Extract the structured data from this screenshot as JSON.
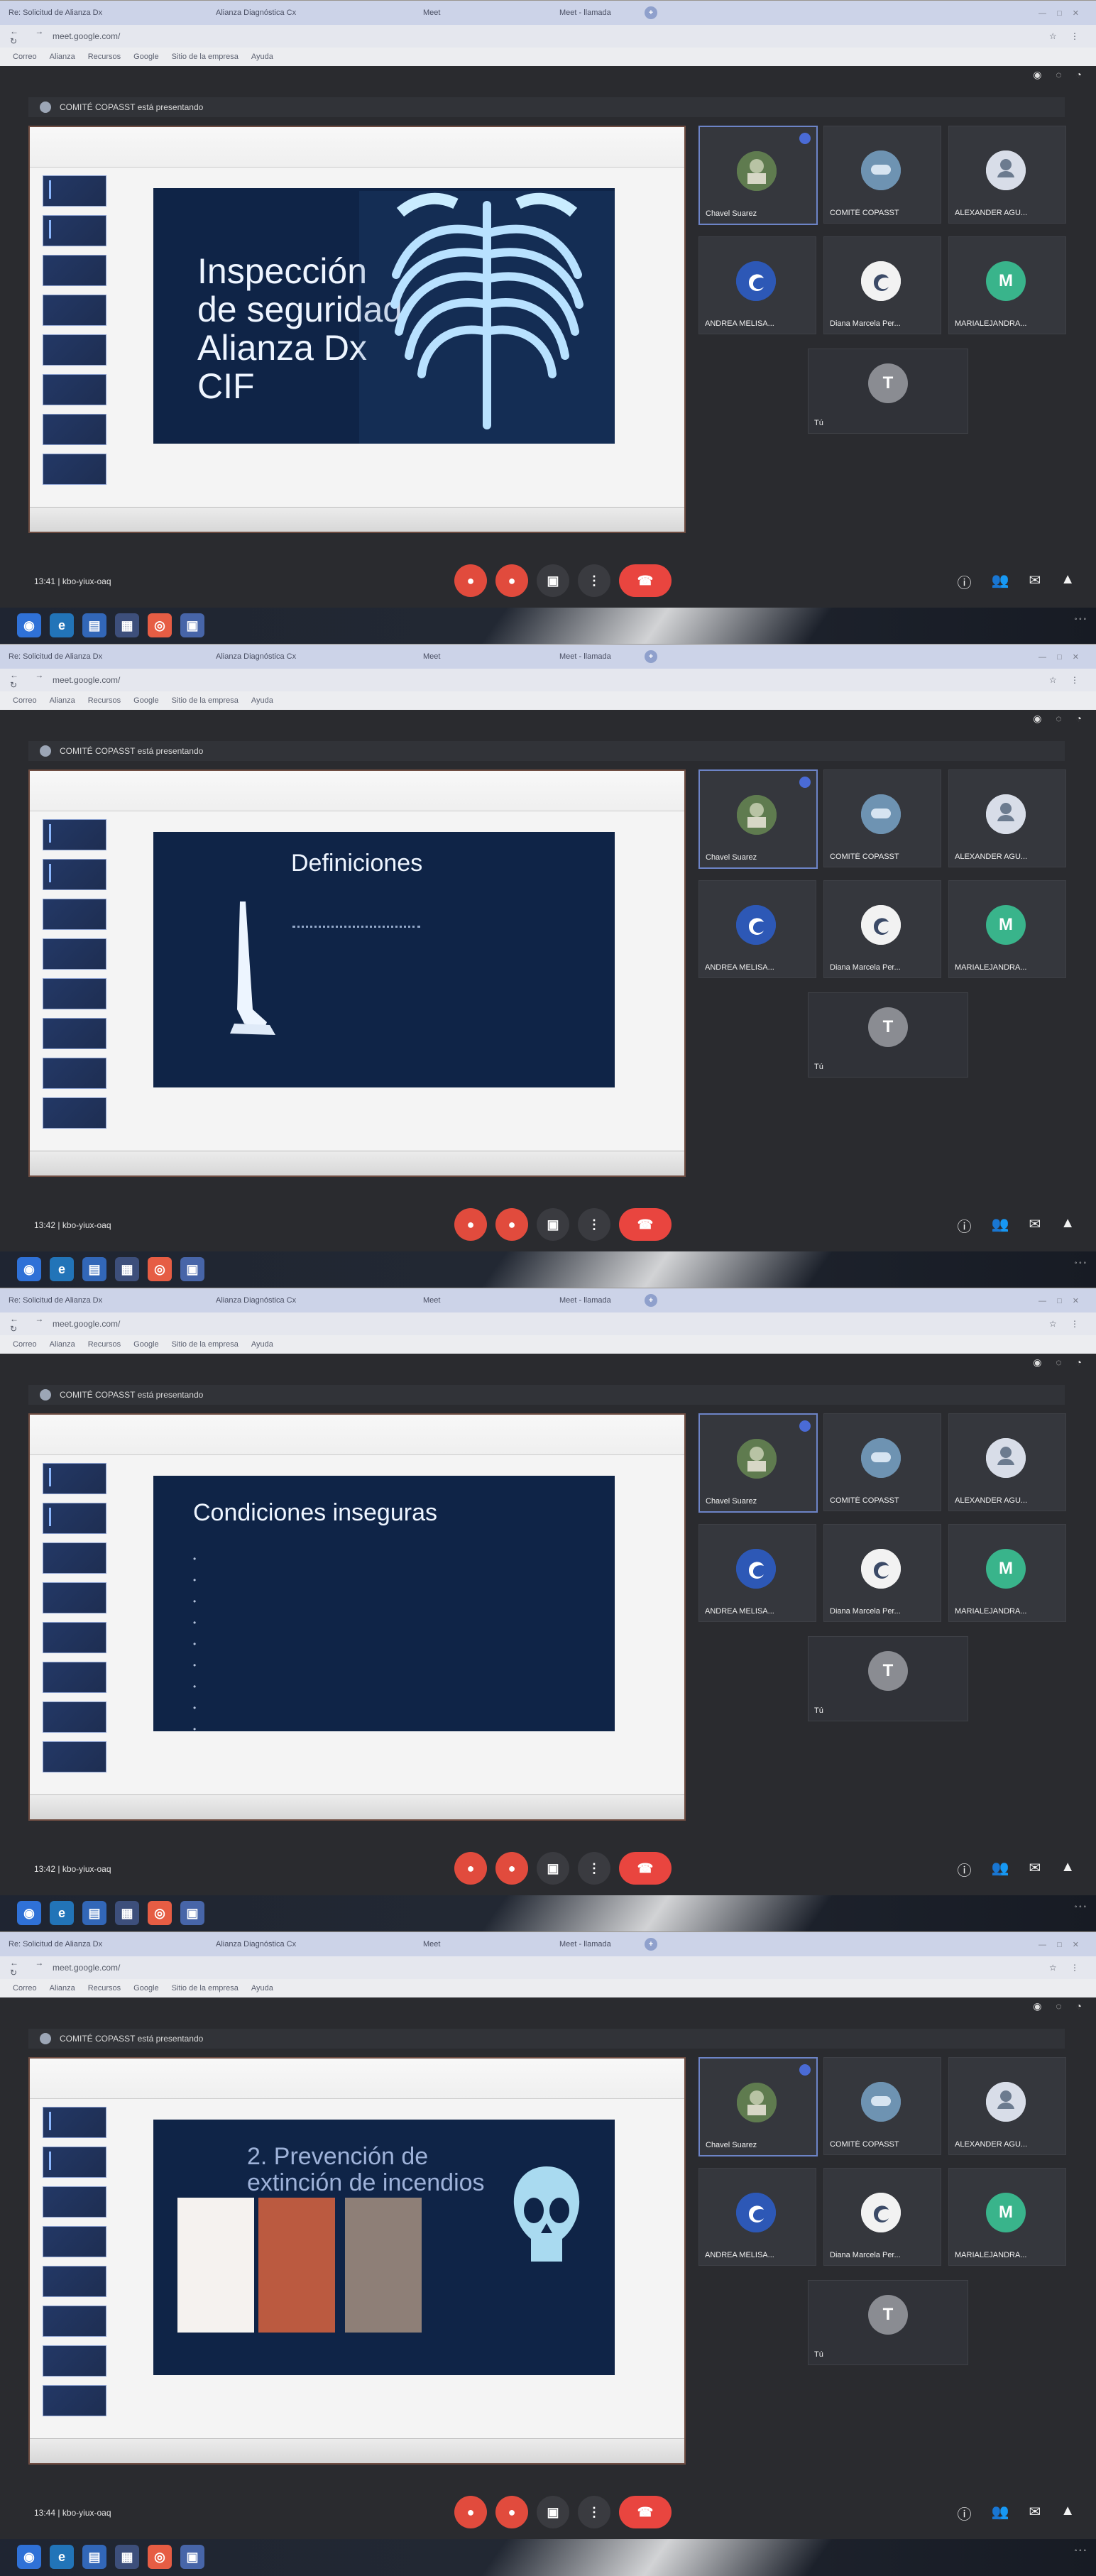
{
  "browser": {
    "tab_labels": [
      "Re: Solicitud de Alianza Dx",
      "Alianza Diagnóstica Cx",
      "Meet",
      "Meet - llamada"
    ],
    "address": "meet.google.com/",
    "bookmarks": [
      "Correo",
      "Alianza",
      "Recursos",
      "Google",
      "Sitio de la empresa",
      "Ayuda"
    ]
  },
  "meeting": {
    "presenting_label": "COMITÉ COPASST está presentando",
    "participants": [
      {
        "name": "Chavel Suarez",
        "initial": "",
        "color": "#5f7b4f",
        "icon": "photo-avatar"
      },
      {
        "name": "COMITÉ COPASST",
        "initial": "",
        "color": "#6e93b2",
        "icon": "group-icon"
      },
      {
        "name": "ALEXANDER AGU...",
        "initial": "",
        "color": "#d8dde8",
        "icon": "user-icon"
      },
      {
        "name": "ANDREA MELISA...",
        "initial": "",
        "color": "#2d58b6",
        "icon": "brand-icon"
      },
      {
        "name": "Diana Marcela Per...",
        "initial": "",
        "color": "#f2f2f2",
        "icon": "brand-icon"
      },
      {
        "name": "MARIALEJANDRA...",
        "initial": "M",
        "color": "#39b48b",
        "icon": ""
      },
      {
        "name": "Tú",
        "initial": "T",
        "color": "#8a8c92",
        "icon": ""
      }
    ]
  },
  "screens": [
    {
      "slide_title_lines": [
        "Inspección",
        "de seguridad",
        "Alianza Dx",
        "CIF"
      ],
      "time": "13:41 | kbo-yiux-oaq",
      "variant": "variant1"
    },
    {
      "slide_title_lines": [
        "Definiciones"
      ],
      "time": "13:42 | kbo-yiux-oaq",
      "variant": "variant2"
    },
    {
      "slide_title_lines": [
        "Condiciones inseguras"
      ],
      "time": "13:42 | kbo-yiux-oaq",
      "variant": "variant3"
    },
    {
      "slide_title_lines": [
        "2. Prevención de",
        "extinción de incendios"
      ],
      "time": "13:44 | kbo-yiux-oaq",
      "variant": "variant4"
    }
  ]
}
